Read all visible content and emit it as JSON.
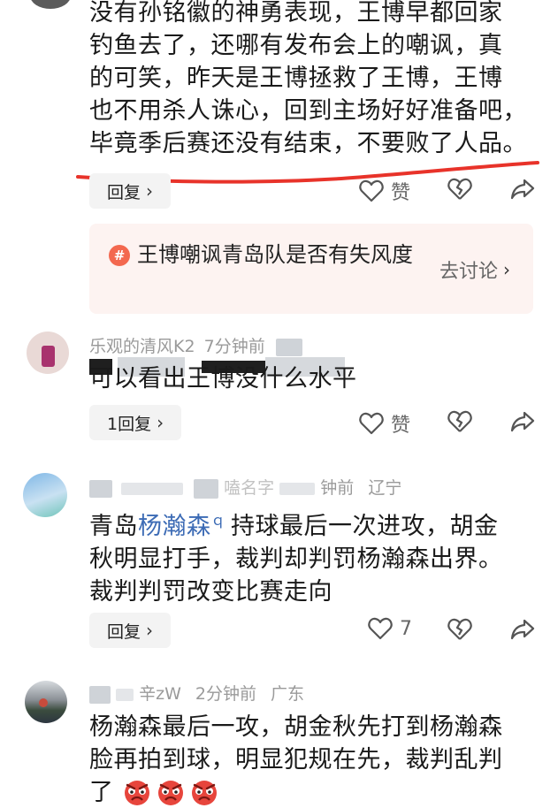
{
  "comment_top": {
    "text_lines": [
      "没有孙铭徽的神勇表现，王博早都回家",
      "钓鱼去了，还哪有发布会上的嘲讽，真",
      "的可笑，昨天是王博拯救了王博，王博",
      "也不用杀人诛心，回到主场好好准备吧，",
      "毕竟季后赛还没有结束，不要败了人品。"
    ],
    "reply_label": "回复",
    "like_label": "赞"
  },
  "topic": {
    "hash": "#",
    "text": "王博嘲讽青岛队是否有失风度",
    "action_label": "去讨论"
  },
  "comment_2": {
    "username": "乐观的清风K2",
    "time": "7分钟前",
    "text": "可以看出王博没什么水平",
    "reply_label": "1回复",
    "like_label": "赞"
  },
  "comment_3": {
    "username_fragment": "嗑名字",
    "time": "钟前",
    "location": "辽宁",
    "text_prefix": "青岛",
    "mention": "杨瀚森",
    "text_lines": [
      "持球最后一次进攻，胡金",
      "秋明显打手，裁判却判罚杨瀚森出界。",
      "裁判判罚改变比赛走向"
    ],
    "reply_label": "回复",
    "like_count": "7"
  },
  "comment_4": {
    "username_fragment": "辛zW",
    "time": "2分钟前",
    "location": "广东",
    "text_lines": [
      "杨瀚森最后一攻，胡金秋先打到杨瀚森",
      "脸再拍到球，明显犯规在先，裁判乱判",
      "了"
    ]
  },
  "colors": {
    "accent_red": "#e8332a",
    "mention_blue": "#3c6bb5",
    "topic_bg": "#fdf3f1",
    "hash_bg": "#f3684f",
    "meta_gray": "#9a9a9a"
  },
  "icons": [
    "chevron-right-icon",
    "heart-icon",
    "broken-heart-icon",
    "share-icon",
    "hash-icon",
    "angry-emoji-icon"
  ]
}
